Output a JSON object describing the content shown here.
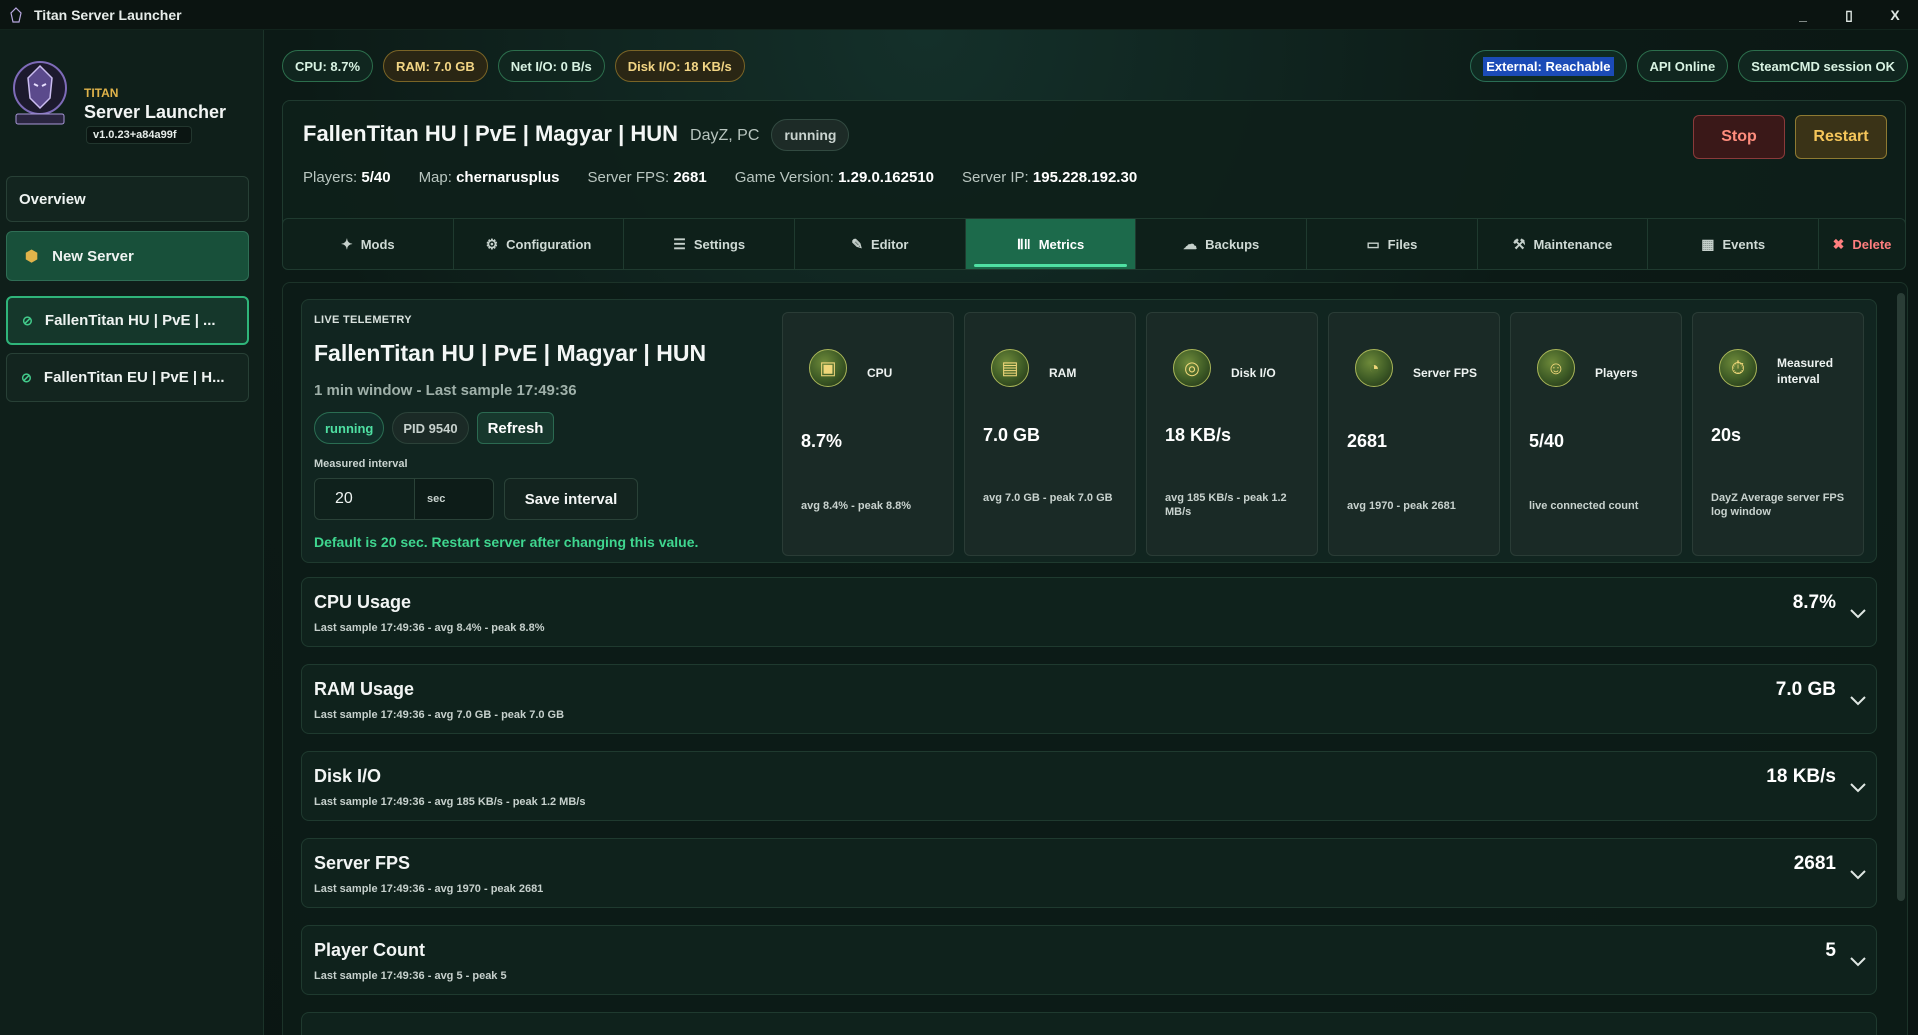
{
  "window": {
    "title": "Titan Server Launcher",
    "controls": [
      "_",
      "▯",
      "X"
    ]
  },
  "sidebar": {
    "brand_small": "TITAN",
    "brand_name": "Server Launcher",
    "version": "v1.0.23+a84a99f",
    "overview_label": "Overview",
    "new_server_label": "New Server",
    "servers": [
      {
        "label": "FallenTitan HU | PvE | ..."
      },
      {
        "label": "FallenTitan EU | PvE | H..."
      }
    ]
  },
  "status_pills": {
    "cpu": "CPU: 8.7%",
    "ram": "RAM: 7.0 GB",
    "net": "Net I/O: 0 B/s",
    "disk": "Disk I/O: 18 KB/s",
    "external": "External: Reachable",
    "api": "API Online",
    "steamcmd": "SteamCMD session OK"
  },
  "server": {
    "title": "FallenTitan HU | PvE | Magyar | HUN",
    "subtitle": "DayZ, PC",
    "status": "running",
    "players_label": "Players:",
    "players_value": "5/40",
    "map_label": "Map:",
    "map_value": "chernarusplus",
    "fps_label": "Server FPS:",
    "fps_value": "2681",
    "version_label": "Game Version:",
    "version_value": "1.29.0.162510",
    "ip_label": "Server IP:",
    "ip_value": "195.228.192.30",
    "stop_label": "Stop",
    "restart_label": "Restart"
  },
  "tabs": [
    {
      "label": "Mods",
      "icon": "puzzle-icon"
    },
    {
      "label": "Configuration",
      "icon": "gear-icon"
    },
    {
      "label": "Settings",
      "icon": "sliders-icon"
    },
    {
      "label": "Editor",
      "icon": "pencil-icon"
    },
    {
      "label": "Metrics",
      "icon": "bar-chart-icon"
    },
    {
      "label": "Backups",
      "icon": "cloud-icon"
    },
    {
      "label": "Files",
      "icon": "folder-icon"
    },
    {
      "label": "Maintenance",
      "icon": "tools-icon"
    },
    {
      "label": "Events",
      "icon": "calendar-icon"
    },
    {
      "label": "Delete",
      "icon": "trash-icon"
    }
  ],
  "telemetry": {
    "heading": "LIVE TELEMETRY",
    "title": "FallenTitan HU | PvE | Magyar | HUN",
    "window_text": "1 min window - Last sample 17:49:36",
    "status": "running",
    "pid": "PID 9540",
    "refresh_label": "Refresh",
    "interval_label": "Measured interval",
    "interval_value": "20",
    "interval_unit": "sec",
    "save_label": "Save interval",
    "note": "Default is 20 sec. Restart server after changing this value.",
    "cards": [
      {
        "label": "CPU",
        "value": "8.7%",
        "sub": "avg 8.4% - peak 8.8%",
        "icon": "cpu-icon"
      },
      {
        "label": "RAM",
        "value": "7.0 GB",
        "sub": "avg 7.0 GB - peak 7.0 GB",
        "icon": "memory-icon"
      },
      {
        "label": "Disk I/O",
        "value": "18 KB/s",
        "sub": "avg 185 KB/s - peak 1.2 MB/s",
        "icon": "disk-icon"
      },
      {
        "label": "Server FPS",
        "value": "2681",
        "sub": "avg 1970 - peak 2681",
        "icon": "gauge-icon"
      },
      {
        "label": "Players",
        "value": "5/40",
        "sub": "live connected count",
        "icon": "players-icon"
      },
      {
        "label": "Measured interval",
        "value": "20s",
        "sub": "DayZ Average server FPS log window",
        "icon": "stopwatch-icon"
      }
    ]
  },
  "metrics": [
    {
      "title": "CPU Usage",
      "sub": "Last sample 17:49:36 - avg 8.4% - peak 8.8%",
      "value": "8.7%"
    },
    {
      "title": "RAM Usage",
      "sub": "Last sample 17:49:36 - avg 7.0 GB - peak 7.0 GB",
      "value": "7.0 GB"
    },
    {
      "title": "Disk I/O",
      "sub": "Last sample 17:49:36 - avg 185 KB/s - peak 1.2 MB/s",
      "value": "18 KB/s"
    },
    {
      "title": "Server FPS",
      "sub": "Last sample 17:49:36 - avg 1970 - peak 2681",
      "value": "2681"
    },
    {
      "title": "Player Count",
      "sub": "Last sample 17:49:36 - avg 5 - peak 5",
      "value": "5"
    }
  ],
  "colors": {
    "accent": "#2fb57a",
    "background": "#0a1512",
    "active_tab": "#1c6a4b",
    "danger": "#ff7f7f",
    "warning": "#f5c65a"
  }
}
